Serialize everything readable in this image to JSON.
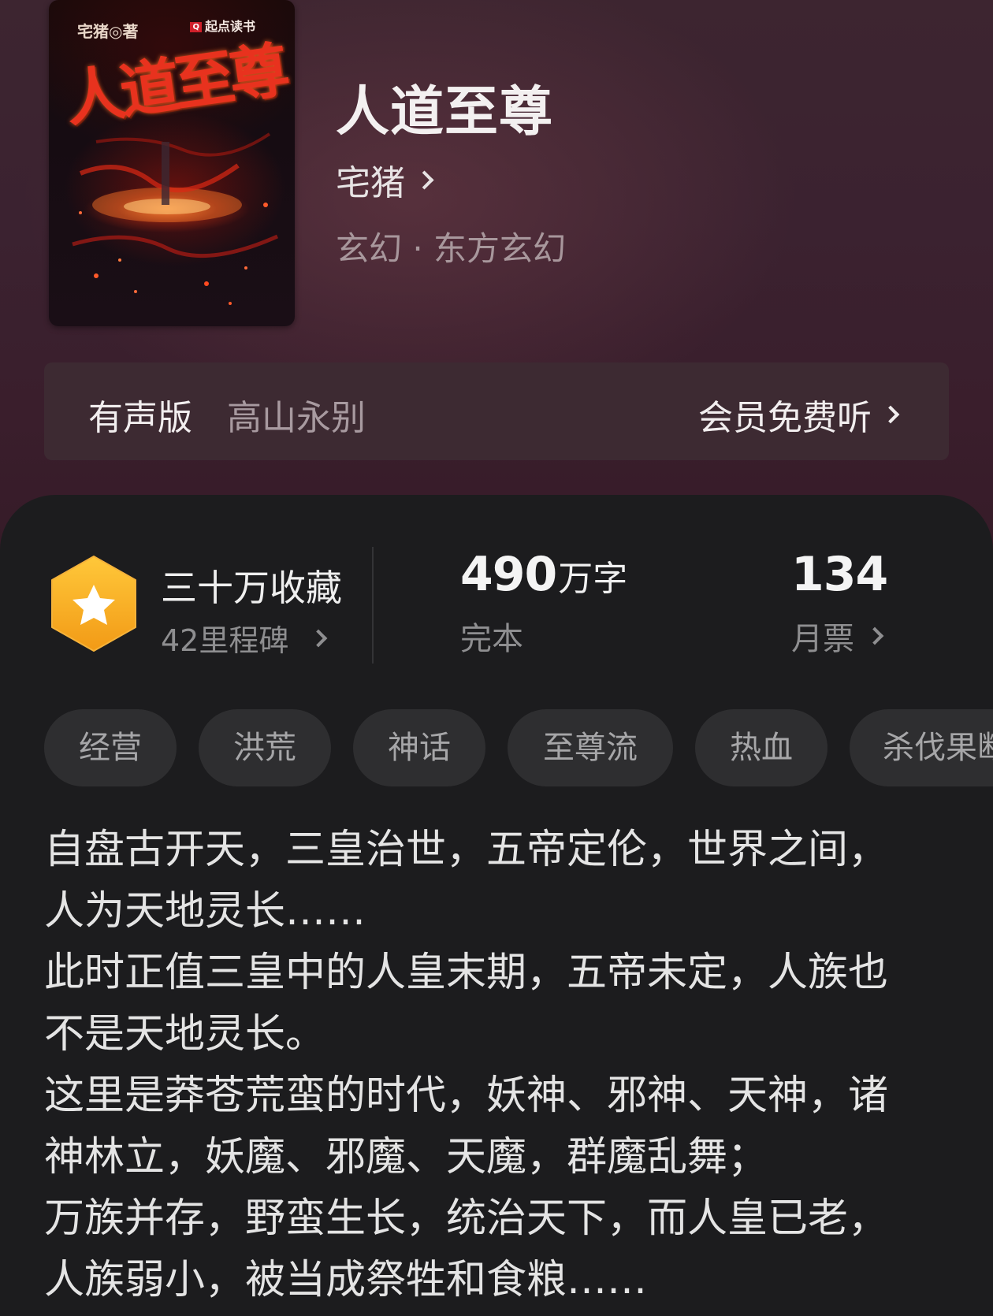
{
  "book": {
    "title": "人道至尊",
    "author": "宅猪",
    "genre": "玄幻 · 东方玄幻",
    "cover": {
      "title_art": "人道至尊",
      "author_mark": "宅猪◎著",
      "publisher": "起点读书"
    }
  },
  "audio": {
    "label": "有声版",
    "narrator": "高山永别",
    "cta": "会员免费听"
  },
  "stats": {
    "collections": "三十万收藏",
    "milestones": "42里程碑",
    "word_count": "490",
    "word_unit": "万字",
    "status": "完本",
    "monthly_votes": "134",
    "votes_label": "月票"
  },
  "tags": [
    "经营",
    "洪荒",
    "神话",
    "至尊流",
    "热血",
    "杀伐果断"
  ],
  "synopsis": [
    "自盘古开天，三皇治世，五帝定伦，世界之间，",
    "人为天地灵长……",
    "此时正值三皇中的人皇末期，五帝未定，人族也",
    "不是天地灵长。",
    "这里是莽苍荒蛮的时代，妖神、邪神、天神，诸",
    "神林立，妖魔、邪魔、天魔，群魔乱舞；",
    "万族并存，野蛮生长，统治天下，而人皇已老，",
    "人族弱小，被当成祭牲和食粮……"
  ],
  "colors": {
    "header_bg": "#3b2230",
    "card_bg": "#1c1c1e",
    "badge_orange": "#f5a623",
    "tag_bg": "#2e2e30"
  }
}
